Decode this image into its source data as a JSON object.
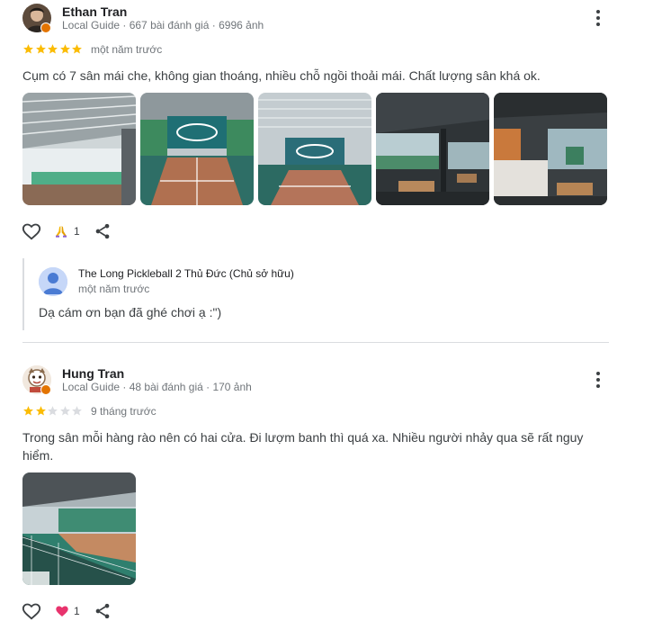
{
  "colors": {
    "star_filled": "#fbbc04",
    "star_empty": "#dadce0",
    "heart_reaction": "#e8336d",
    "badge": "#e37400",
    "text_secondary": "#70757a"
  },
  "reviews": [
    {
      "author": "Ethan Tran",
      "meta": "Local Guide · 667 bài đánh giá · 6996 ảnh",
      "rating": 5,
      "date": "một năm trước",
      "text": "Cụm có 7 sân mái che, không gian thoáng, nhiều chỗ ngồi thoải mái. Chất lượng sân khá ok.",
      "photo_count": 5,
      "reaction_icon": "pray-hands-icon",
      "reaction_count": "1",
      "owner_response": {
        "name": "The Long Pickleball 2 Thủ Đức (Chủ sở hữu)",
        "date": "một năm trước",
        "text": "Dạ cám ơn bạn đã ghé chơi ạ :\")"
      }
    },
    {
      "author": "Hung Tran",
      "meta": "Local Guide · 48 bài đánh giá · 170 ảnh",
      "rating": 2,
      "date": "9 tháng trước",
      "text_line1": "Trong sân mỗi hàng rào nên có hai cửa. Đi lượm banh thì quá xa. Nhiều người nhảy qua sẽ rất nguy",
      "text_line2": "hiểm.",
      "photo_count": 1,
      "reaction_icon": "heart-icon",
      "reaction_count": "1"
    }
  ]
}
